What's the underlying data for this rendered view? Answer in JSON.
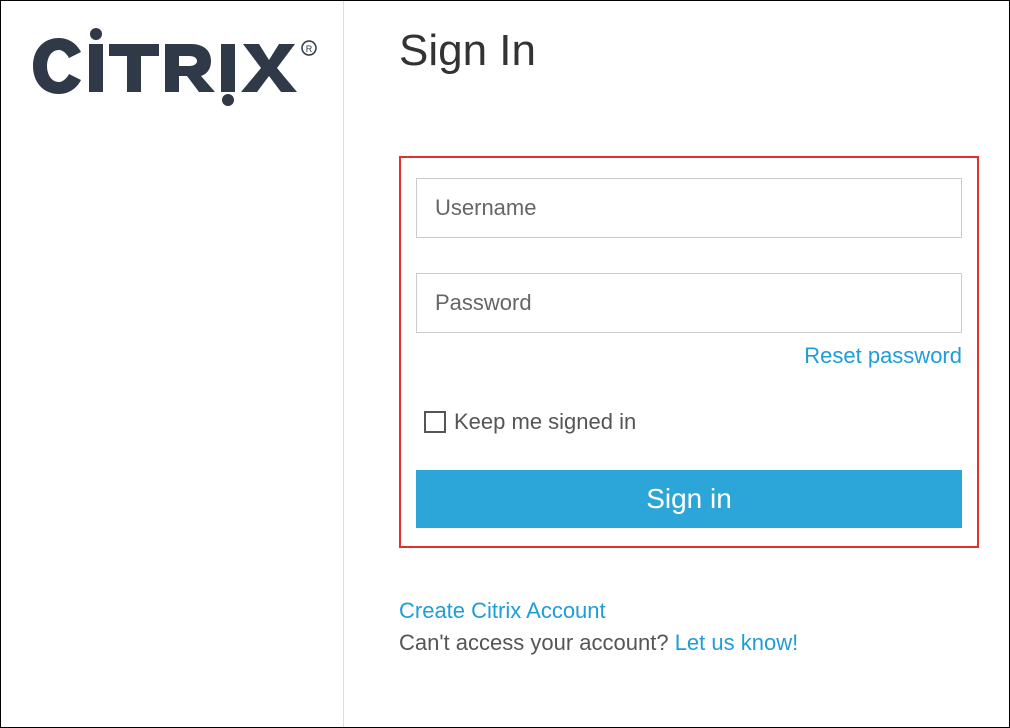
{
  "logo": {
    "name": "citrix-logo",
    "text": "CITRIX"
  },
  "page_title": "Sign In",
  "form": {
    "username_placeholder": "Username",
    "password_placeholder": "Password",
    "reset_password_label": "Reset password",
    "keep_signed_in_label": "Keep me signed in",
    "signin_button_label": "Sign in"
  },
  "footer": {
    "create_account_label": "Create Citrix Account",
    "cant_access_prefix": "Can't access your account? ",
    "let_us_know_label": "Let us know!"
  },
  "colors": {
    "highlight_border": "#e03030",
    "link": "#1f9dd8",
    "button": "#2ca6d8",
    "logo_fill": "#2f3947"
  }
}
